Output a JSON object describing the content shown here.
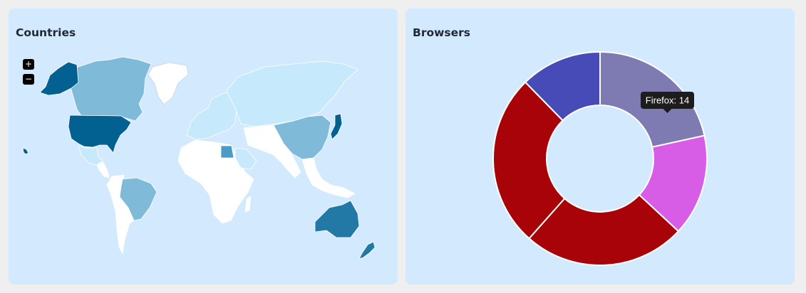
{
  "countries_card": {
    "title": "Countries",
    "zoom_in_label": "+",
    "zoom_out_label": "−"
  },
  "browsers_card": {
    "title": "Browsers"
  },
  "colors": {
    "ocean": "#d3e9fd",
    "card_bg": "#d3e9fd",
    "page_bg": "#efefef",
    "map_none": "#ffffff",
    "map_lightest": "#c6eafb",
    "map_light": "#7fbad8",
    "map_mid": "#4b9bc4",
    "map_dark": "#2279a6",
    "map_darkest": "#036191"
  },
  "chart_data": [
    {
      "type": "choropleth",
      "regions": [
        {
          "name": "United States",
          "level": 5
        },
        {
          "name": "Alaska",
          "level": 5
        },
        {
          "name": "Hawaii",
          "level": 5
        },
        {
          "name": "Australia",
          "level": 4
        },
        {
          "name": "New Zealand",
          "level": 4
        },
        {
          "name": "Japan",
          "level": 4
        },
        {
          "name": "Canada",
          "level": 2
        },
        {
          "name": "Brazil",
          "level": 2
        },
        {
          "name": "China",
          "level": 2
        },
        {
          "name": "Egypt",
          "level": 3
        },
        {
          "name": "Russia",
          "level": 1
        },
        {
          "name": "Europe",
          "level": 1
        },
        {
          "name": "Saudi Arabia",
          "level": 1
        },
        {
          "name": "Mexico",
          "level": 1
        }
      ]
    },
    {
      "type": "pie",
      "labels": [
        "Firefox",
        "",
        "",
        "",
        ""
      ],
      "values": [
        14,
        10,
        16,
        17,
        8
      ],
      "colors": [
        "#7d7bb1",
        "#d75ce6",
        "#a80308",
        "#a80308",
        "#474bb8"
      ],
      "tooltip": "Firefox: 14"
    }
  ]
}
